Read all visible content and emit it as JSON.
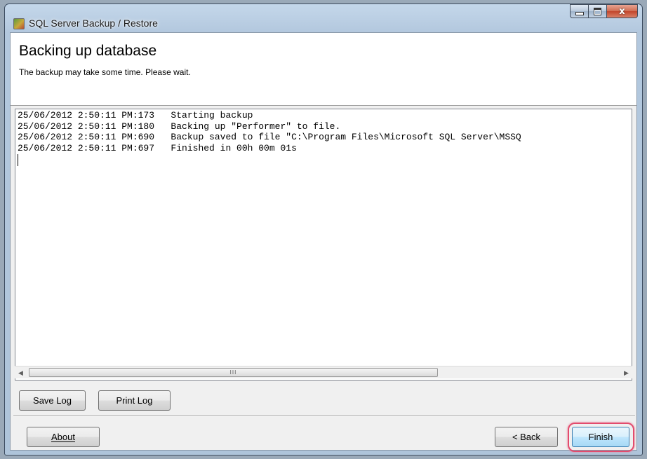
{
  "window": {
    "title": "SQL Server Backup / Restore",
    "close_glyph": "x"
  },
  "header": {
    "title": "Backing up database",
    "subtitle": "The backup may take some time. Please wait."
  },
  "log": {
    "lines": [
      "25/06/2012 2:50:11 PM:173   Starting backup",
      "25/06/2012 2:50:11 PM:180   Backing up \"Performer\" to file.",
      "25/06/2012 2:50:11 PM:690   Backup saved to file \"C:\\Program Files\\Microsoft SQL Server\\MSSQ",
      "25/06/2012 2:50:11 PM:697   Finished in 00h 00m 01s"
    ],
    "scroll_thumb_grip": "III"
  },
  "buttons": {
    "save_log": "Save Log",
    "print_log": "Print Log",
    "about": "About",
    "back": "< Back",
    "finish": "Finish"
  },
  "icons": {
    "app": "app-icon",
    "minimize": "minimize-icon",
    "maximize": "maximize-icon",
    "close": "close-icon",
    "scroll_left": "scroll-left-arrow-icon",
    "scroll_right": "scroll-right-arrow-icon"
  },
  "colors": {
    "highlight": "#e34b6d"
  }
}
